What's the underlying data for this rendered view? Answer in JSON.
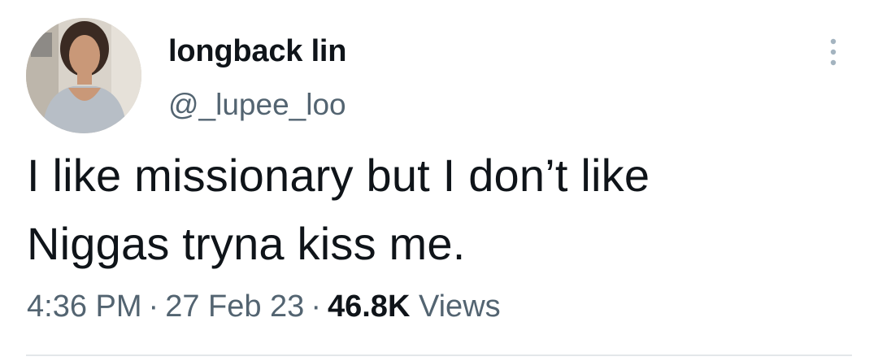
{
  "author": {
    "display_name": "longback lin",
    "handle": "@_lupee_loo",
    "avatar_icon": "user-avatar"
  },
  "tweet": {
    "text_line_1": "I like missionary but I don’t like",
    "text_line_2": "Niggas tryna kiss me."
  },
  "meta": {
    "time": "4:36 PM",
    "separator": "·",
    "date": "27 Feb 23",
    "views_count": "46.8K",
    "views_label": "Views"
  },
  "more_menu": {
    "icon": "more-vertical-icon"
  },
  "colors": {
    "text_primary": "#0f1419",
    "text_secondary": "#536471",
    "more_icon": "#a4b4c0",
    "divider": "#e3e7ea"
  }
}
